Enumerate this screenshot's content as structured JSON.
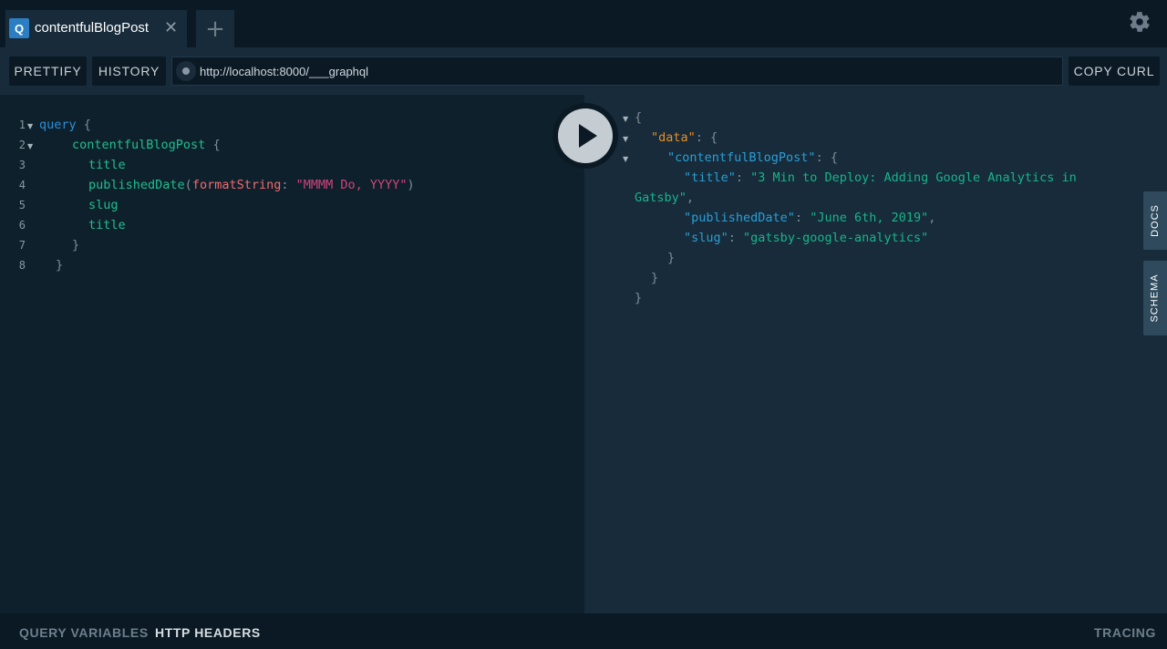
{
  "tabs": {
    "active": {
      "badge": "Q",
      "label": "contentfulBlogPost",
      "close": "✕"
    },
    "add": "+"
  },
  "toolbar": {
    "prettify": "PRETTIFY",
    "history": "HISTORY",
    "url": "http://localhost:8000/___graphql",
    "copy_curl": "COPY CURL"
  },
  "query_editor": {
    "line_numbers": [
      "1",
      "2",
      "3",
      "4",
      "5",
      "6",
      "7",
      "8"
    ],
    "lines": {
      "l1_kw": "query",
      "l1_brace": " {",
      "l2_field": "contentfulBlogPost",
      "l2_brace": " {",
      "l3": "title",
      "l4_field": "publishedDate",
      "l4_open": "(",
      "l4_arg": "formatString",
      "l4_colon": ": ",
      "l4_str": "\"MMMM Do, YYYY\"",
      "l4_close": ")",
      "l5": "slug",
      "l6": "title",
      "l7": "}",
      "l8": "}"
    }
  },
  "result": {
    "open": "{",
    "data_key": "\"data\"",
    "data_sep": ": {",
    "post_key": "\"contentfulBlogPost\"",
    "post_sep": ": {",
    "title_key": "\"title\"",
    "title_sep": ": ",
    "title_val_1": "\"3 Min to Deploy: Adding Google Analytics in",
    "title_val_2": "Gatsby\"",
    "title_end": ",",
    "date_key": "\"publishedDate\"",
    "date_sep": ": ",
    "date_val": "\"June 6th, 2019\"",
    "date_end": ",",
    "slug_key": "\"slug\"",
    "slug_sep": ": ",
    "slug_val": "\"gatsby-google-analytics\"",
    "close1": "}",
    "close2": "}",
    "close3": "}"
  },
  "side_tabs": {
    "docs": "DOCS",
    "schema": "SCHEMA"
  },
  "bottom": {
    "query_variables": "QUERY VARIABLES",
    "http_headers": "HTTP HEADERS",
    "tracing": "TRACING"
  },
  "colors": {
    "accent": "#2b7ec1",
    "string": "#1ab38a",
    "data_key": "#e68f25",
    "arg": "#f26b6b"
  }
}
